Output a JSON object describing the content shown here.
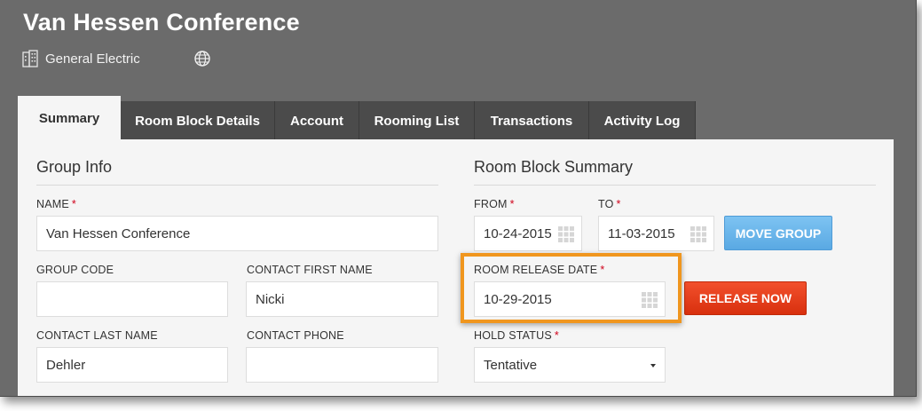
{
  "header": {
    "title": "Van Hessen Conference",
    "company": "General Electric"
  },
  "tabs": [
    {
      "label": "Summary",
      "active": true
    },
    {
      "label": "Room Block Details",
      "active": false
    },
    {
      "label": "Account",
      "active": false
    },
    {
      "label": "Rooming List",
      "active": false
    },
    {
      "label": "Transactions",
      "active": false
    },
    {
      "label": "Activity Log",
      "active": false
    }
  ],
  "group_info": {
    "title": "Group Info",
    "name_label": "NAME",
    "name_value": "Van Hessen Conference",
    "group_code_label": "GROUP CODE",
    "group_code_value": "",
    "contact_first_label": "CONTACT FIRST NAME",
    "contact_first_value": "Nicki",
    "contact_last_label": "CONTACT LAST NAME",
    "contact_last_value": "Dehler",
    "contact_phone_label": "CONTACT PHONE",
    "contact_phone_value": ""
  },
  "room_block": {
    "title": "Room Block Summary",
    "from_label": "FROM",
    "from_value": "10-24-2015",
    "to_label": "TO",
    "to_value": "11-03-2015",
    "move_group_label": "MOVE GROUP",
    "release_date_label": "ROOM RELEASE DATE",
    "release_date_value": "10-29-2015",
    "release_now_label": "RELEASE NOW",
    "hold_status_label": "HOLD STATUS",
    "hold_status_value": "Tentative"
  },
  "required_mark": "*",
  "colors": {
    "header_bg": "#6b6b6b",
    "tab_bg": "#4b4b4b",
    "panel_bg": "#f5f5f5",
    "required": "#d0021b",
    "move_button": "#5aa9e3",
    "release_button": "#d8300e",
    "highlight": "#f0961e"
  },
  "icons": [
    "building-icon",
    "globe-icon",
    "calendar-icon",
    "dropdown-caret-icon"
  ]
}
